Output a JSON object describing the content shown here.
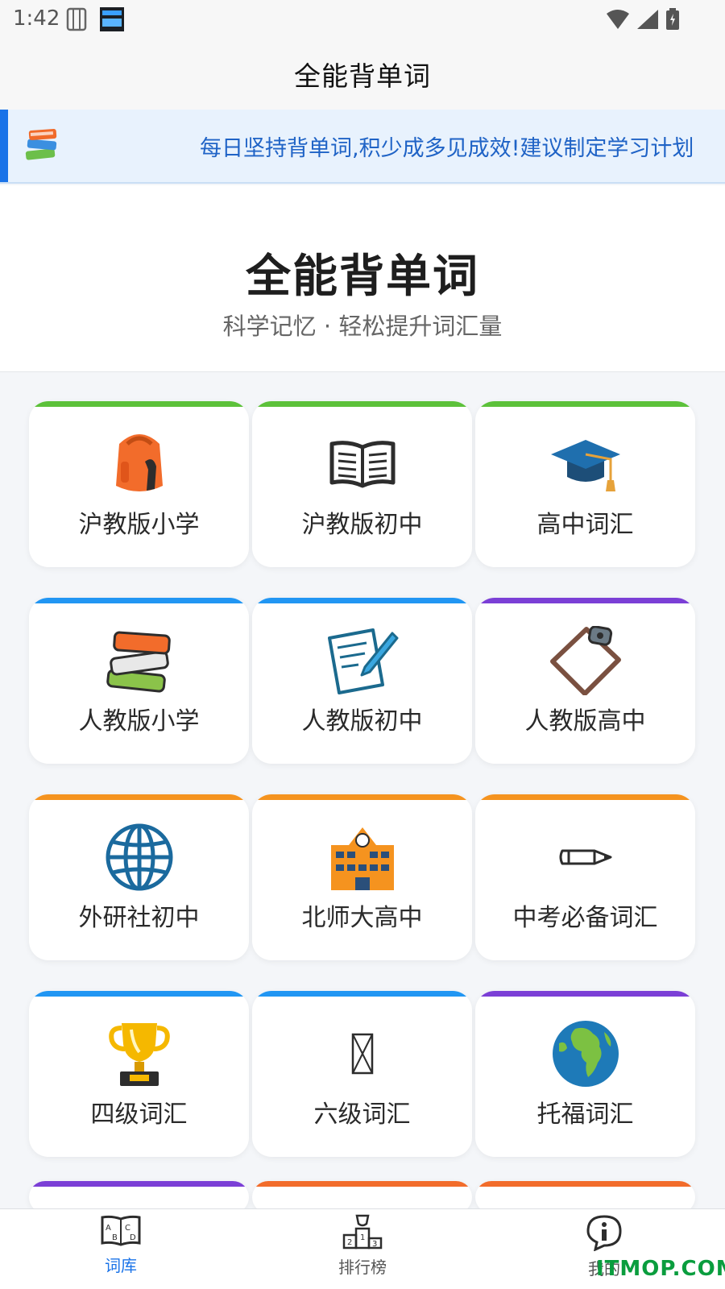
{
  "status_bar": {
    "time": "1:42"
  },
  "app_bar": {
    "title": "全能背单词"
  },
  "notice": {
    "text": "每日坚持背单词,积少成多见成效!建议制定学习计划"
  },
  "hero": {
    "title": "全能背单词",
    "subtitle": "科学记忆 · 轻松提升词汇量"
  },
  "categories": [
    {
      "label": "沪教版小学",
      "icon": "backpack-icon",
      "accent": "#5cc13a"
    },
    {
      "label": "沪教版初中",
      "icon": "open-book-icon",
      "accent": "#5cc13a"
    },
    {
      "label": "高中词汇",
      "icon": "graduation-cap-icon",
      "accent": "#5cc13a"
    },
    {
      "label": "人教版小学",
      "icon": "books-stack-icon",
      "accent": "#2196f3"
    },
    {
      "label": "人教版初中",
      "icon": "memo-icon",
      "accent": "#2196f3"
    },
    {
      "label": "人教版高中",
      "icon": "clipboard-icon",
      "accent": "#7b3fd6"
    },
    {
      "label": "外研社初中",
      "icon": "globe-icon",
      "accent": "#f5931f"
    },
    {
      "label": "北师大高中",
      "icon": "school-icon",
      "accent": "#f5931f"
    },
    {
      "label": "中考必备词汇",
      "icon": "pencil-icon",
      "accent": "#f5931f"
    },
    {
      "label": "四级词汇",
      "icon": "trophy-icon",
      "accent": "#2196f3"
    },
    {
      "label": "六级词汇",
      "icon": "missing-glyph-icon",
      "accent": "#2196f3"
    },
    {
      "label": "托福词汇",
      "icon": "earth-icon",
      "accent": "#7b3fd6"
    }
  ],
  "bottom_nav": [
    {
      "label": "词库",
      "icon": "dictionary-icon",
      "active": true,
      "color": "#1a73e8"
    },
    {
      "label": "排行榜",
      "icon": "podium-icon",
      "active": false,
      "color": "#555555"
    },
    {
      "label": "我的",
      "icon": "info-icon",
      "active": false,
      "color": "#555555"
    }
  ],
  "watermark": {
    "text": "ITMOP.COM"
  },
  "colors": {
    "primary": "#1a73e8",
    "notice_bg": "#e8f2fd"
  }
}
